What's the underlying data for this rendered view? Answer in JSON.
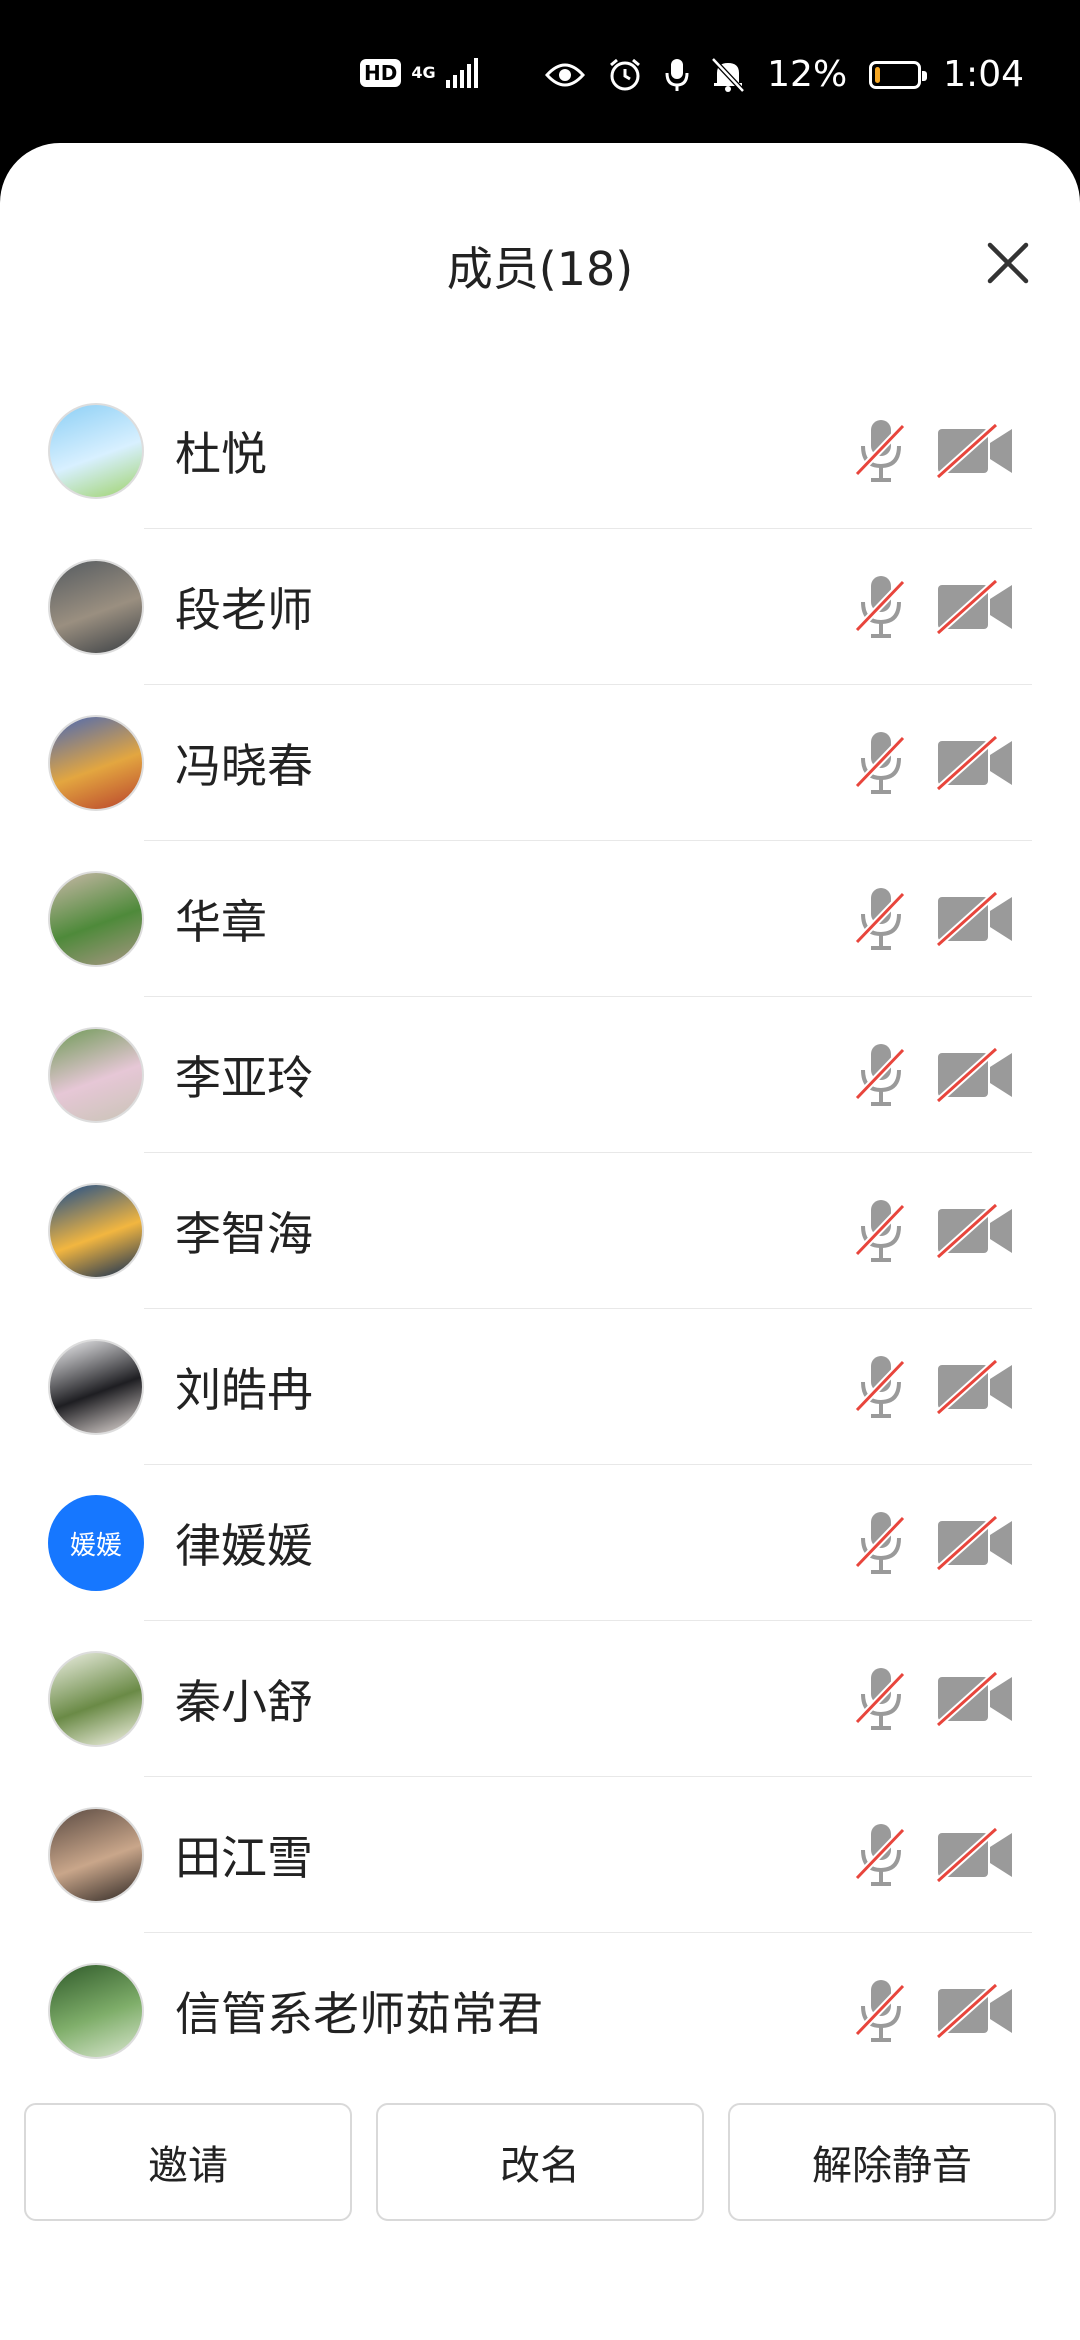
{
  "status_bar": {
    "hd_badge": "HD",
    "network": "4G",
    "battery_percent": "12%",
    "battery_level": 0.12,
    "time": "1:04",
    "icons": [
      "eye-icon",
      "alarm-icon",
      "mic-icon",
      "bell-off-icon"
    ]
  },
  "header": {
    "title": "成员(18)",
    "close_icon": "close-icon"
  },
  "members": [
    {
      "name": "杜悦",
      "avatar": {
        "type": "image",
        "colors": [
          "#8ccff5",
          "#d8f0ff",
          "#9ed26a"
        ]
      },
      "mic": "muted",
      "camera": "off"
    },
    {
      "name": "段老师",
      "avatar": {
        "type": "image",
        "colors": [
          "#555b60",
          "#9a8f80",
          "#3a3f44"
        ]
      },
      "mic": "muted",
      "camera": "off"
    },
    {
      "name": "冯晓春",
      "avatar": {
        "type": "image",
        "colors": [
          "#4a68b5",
          "#e3a640",
          "#b8422c"
        ]
      },
      "mic": "muted",
      "camera": "off"
    },
    {
      "name": "华章",
      "avatar": {
        "type": "image",
        "colors": [
          "#c9b8a8",
          "#4e8a3a",
          "#a89684"
        ]
      },
      "mic": "muted",
      "camera": "off"
    },
    {
      "name": "李亚玲",
      "avatar": {
        "type": "image",
        "colors": [
          "#6e9a56",
          "#e6c7d6",
          "#c9c4b6"
        ]
      },
      "mic": "muted",
      "camera": "off"
    },
    {
      "name": "李智海",
      "avatar": {
        "type": "image",
        "colors": [
          "#1a4b8c",
          "#f2b640",
          "#0d2a55"
        ]
      },
      "mic": "muted",
      "camera": "off"
    },
    {
      "name": "刘皓冉",
      "avatar": {
        "type": "image",
        "colors": [
          "#f4f4f6",
          "#1e1e22",
          "#e8e0dc"
        ]
      },
      "mic": "muted",
      "camera": "off"
    },
    {
      "name": "律媛媛",
      "avatar": {
        "type": "text",
        "text": "媛媛",
        "colors": [
          "#1677ff"
        ]
      },
      "mic": "muted",
      "camera": "off"
    },
    {
      "name": "秦小舒",
      "avatar": {
        "type": "image",
        "colors": [
          "#eef0e4",
          "#6a8a46",
          "#f8f6ea"
        ]
      },
      "mic": "muted",
      "camera": "off"
    },
    {
      "name": "田江雪",
      "avatar": {
        "type": "image",
        "colors": [
          "#5a4a42",
          "#c9a68a",
          "#2e2724"
        ]
      },
      "mic": "muted",
      "camera": "off"
    },
    {
      "name": "信管系老师茹常君",
      "avatar": {
        "type": "image",
        "colors": [
          "#2f5a2a",
          "#7fae6a",
          "#d9e6cf"
        ]
      },
      "mic": "muted",
      "camera": "off"
    }
  ],
  "actions": {
    "invite": "邀请",
    "rename": "改名",
    "unmute": "解除静音"
  },
  "colors": {
    "muted_slash": "#e8453c",
    "icon_gray": "#9a9a9a",
    "accent_blue": "#1677ff",
    "battery_low": "#f5a623"
  }
}
